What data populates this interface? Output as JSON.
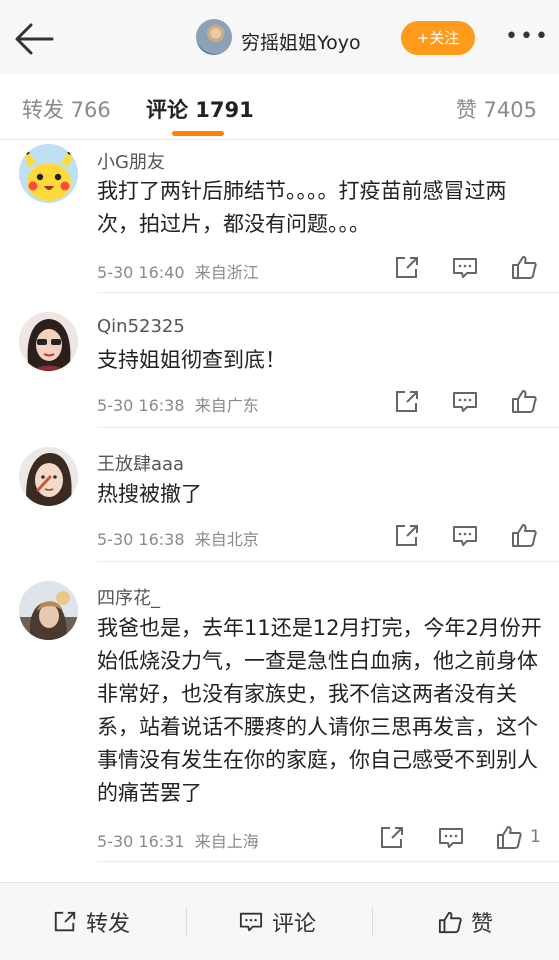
{
  "header": {
    "user_name": "穷摇姐姐Yoyo",
    "follow_label": "+关注",
    "more_label": "•••"
  },
  "tabs": {
    "repost": "转发 766",
    "comment": "评论 1791",
    "like": "赞 7405"
  },
  "comments": [
    {
      "name": "小G朋友",
      "text": "我打了两针后肺结节。。。。打疫苗前感冒过两次，拍过片，都没有问题。。。",
      "time": "5-30 16:40",
      "source": "来自浙江",
      "likes": ""
    },
    {
      "name": "Qin52325",
      "text": "支持姐姐彻查到底！",
      "time": "5-30 16:38",
      "source": "来自广东",
      "likes": ""
    },
    {
      "name": "王放肆aaa",
      "text": "热搜被撤了",
      "time": "5-30 16:38",
      "source": "来自北京",
      "likes": ""
    },
    {
      "name": "四序花_",
      "text": "我爸也是，去年11还是12月打完，今年2月份开始低烧没力气，一查是急性白血病，他之前身体非常好，也没有家族史，我不信这两者没有关系，站着说话不腰疼的人请你三思再发言，这个事情没有发生在你的家庭，你自己感受不到别人的痛苦罢了",
      "time": "5-30 16:31",
      "source": "来自上海",
      "likes": "1"
    }
  ],
  "bottom": {
    "repost_label": "转发",
    "comment_label": "评论",
    "like_label": "赞"
  },
  "colors": {
    "accent": "#ff8200",
    "follow_bg": "#ff9a1a"
  },
  "icons": [
    "back-arrow-icon",
    "more-icon",
    "share-icon",
    "comment-icon",
    "like-icon"
  ]
}
